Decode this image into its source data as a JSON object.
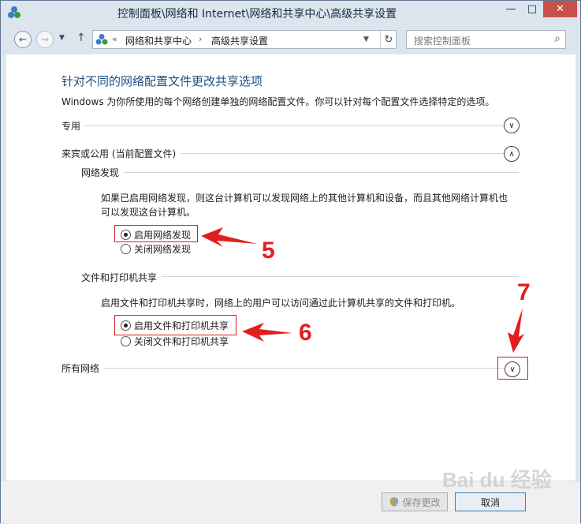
{
  "window": {
    "title": "控制面板\\网络和 Internet\\网络和共享中心\\高级共享设置",
    "minimize": "—",
    "maximize": "□",
    "close": "✕"
  },
  "nav": {
    "back": "←",
    "forward": "→",
    "history_dropdown": "▼",
    "up": "↑",
    "chevron": "«",
    "breadcrumbs": [
      "网络和共享中心",
      "高级共享设置"
    ],
    "separator": "›",
    "address_dropdown": "▼",
    "refresh": "↻",
    "search_placeholder": "搜索控制面板",
    "search_icon_glyph": "⌕"
  },
  "main": {
    "title": "针对不同的网络配置文件更改共享选项",
    "description": "Windows 为你所使用的每个网络创建单独的网络配置文件。你可以针对每个配置文件选择特定的选项。",
    "profiles": [
      {
        "label": "专用",
        "chevron": "∨"
      },
      {
        "label": "来宾或公用 (当前配置文件)",
        "chevron": "∧"
      },
      {
        "label": "所有网络",
        "chevron": "∨"
      }
    ],
    "network_discovery": {
      "heading": "网络发现",
      "description_line1": "如果已启用网络发现，则这台计算机可以发现网络上的其他计算机和设备，而且其他网络计算机也",
      "description_line2": "可以发现这台计算机。",
      "options": [
        "启用网络发现",
        "关闭网络发现"
      ],
      "selected": "启用网络发现"
    },
    "file_printer_sharing": {
      "heading": "文件和打印机共享",
      "description": "启用文件和打印机共享时，网络上的用户可以访问通过此计算机共享的文件和打印机。",
      "options": [
        "启用文件和打印机共享",
        "关闭文件和打印机共享"
      ],
      "selected": "启用文件和打印机共享"
    }
  },
  "annotations": {
    "step5": "5",
    "step6": "6",
    "step7": "7",
    "color": "#e21d1d"
  },
  "footer": {
    "save_label": "保存更改",
    "cancel_label": "取消"
  },
  "watermark": "Bai du 经验"
}
